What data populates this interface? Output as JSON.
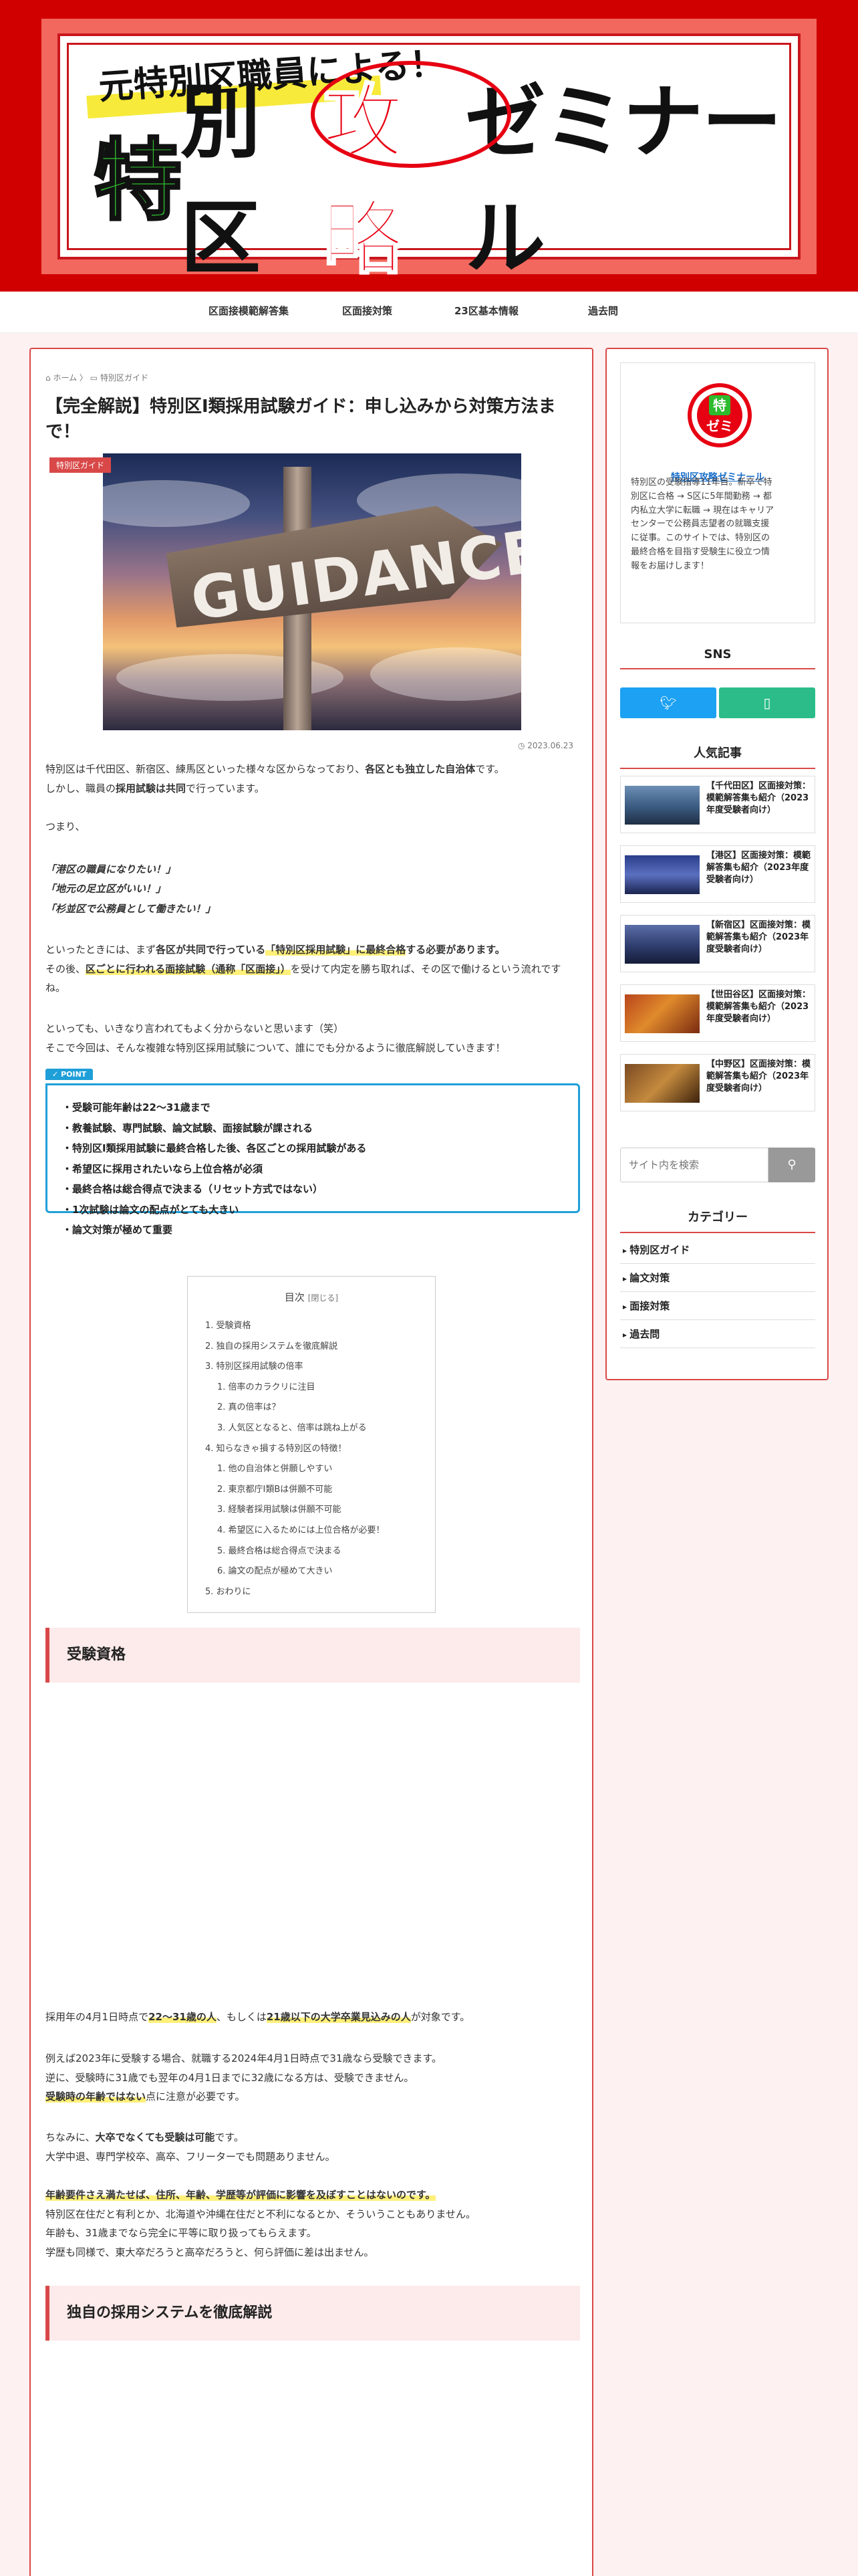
{
  "header": {
    "banner_sub": "元特別区職員による！",
    "banner_first": "特",
    "banner_mid": "別区",
    "banner_red": "攻略",
    "banner_last": "ゼミナール"
  },
  "nav": [
    "区面接模範解答集",
    "区面接対策",
    "23区基本情報",
    "過去問"
  ],
  "breadcrumb": {
    "home": "ホーム",
    "sep": "〉",
    "category": "特別区ガイド"
  },
  "article": {
    "title": "【完全解説】特別区Ⅰ類採用試験ガイド：申し込みから対策方法まで！",
    "category_badge": "特別区ガイド",
    "image_text": "GUIDANCE",
    "date": "2023.06.23",
    "intro1a": "特別区は千代田区、新宿区、練馬区といった様々な区からなっており、",
    "intro1b": "各区とも独立した自治体",
    "intro1c": "です。",
    "intro1d": "しかし、職員の",
    "intro1e": "採用試験は共同",
    "intro1f": "で行っています。",
    "tsumari": "つまり、",
    "quote1": "「港区の職員になりたい！」",
    "quote2": "「地元の足立区がいい！」",
    "quote3": "「杉並区で公務員として働きたい！」",
    "flow1a": "といったときには、まず",
    "flow1b": "各区が共同で行っている",
    "flow1c": "「特別区採用試験」に最終合格",
    "flow1d": "する必要があります。",
    "flow2a": "その後、",
    "flow2b": "区ごとに行われる面接試験（通称「区面接」）",
    "flow2c": "を受けて内定を勝ち取れば、その区で働けるという流れですね。",
    "lead1": "といっても、いきなり言われてもよく分からないと思います（笑）",
    "lead2": "そこで今回は、そんな複雑な特別区採用試験について、誰にでも分かるように徹底解説していきます！"
  },
  "point": {
    "tag": "POINT",
    "items": [
      "・受験可能年齢は22〜31歳まで",
      "・教養試験、専門試験、論文試験、面接試験が課される",
      "・特別区Ⅰ類採用試験に最終合格した後、各区ごとの採用試験がある",
      "・希望区に採用されたいなら上位合格が必須",
      "・最終合格は総合得点で決まる（リセット方式ではない）",
      "・1次試験は論文の配点がとても大きい",
      "・論文対策が極めて重要"
    ]
  },
  "toc": {
    "title": "目次",
    "toggle": "[閉じる]",
    "items": [
      {
        "label": "1. 受験資格",
        "sub": false
      },
      {
        "label": "2. 独自の採用システムを徹底解説",
        "sub": false
      },
      {
        "label": "3. 特別区採用試験の倍率",
        "sub": false
      },
      {
        "label": "1. 倍率のカラクリに注目",
        "sub": true
      },
      {
        "label": "2. 真の倍率は？",
        "sub": true
      },
      {
        "label": "3. 人気区となると、倍率は跳ね上がる",
        "sub": true
      },
      {
        "label": "4. 知らなきゃ損する特別区の特徴！",
        "sub": false
      },
      {
        "label": "1. 他の自治体と併願しやすい",
        "sub": true
      },
      {
        "label": "2. 東京都庁I類Bは併願不可能",
        "sub": true
      },
      {
        "label": "3. 経験者採用試験は併願不可能",
        "sub": true
      },
      {
        "label": "4. 希望区に入るためには上位合格が必要！",
        "sub": true
      },
      {
        "label": "5. 最終合格は総合得点で決まる",
        "sub": true
      },
      {
        "label": "6. 論文の配点が極めて大きい",
        "sub": true
      },
      {
        "label": "5. おわりに",
        "sub": false
      }
    ]
  },
  "section1": {
    "heading": "受験資格",
    "elig1a": "採用年の4月1日時点で",
    "elig1b": "22〜31歳の人",
    "elig1c": "、もしくは",
    "elig1d": "21歳以下の大学卒業見込みの人",
    "elig1e": "が対象です。",
    "ex1": "例えば2023年に受験する場合、就職する2024年4月1日時点で31歳なら受験できます。",
    "ex2": "逆に、受験時に31歳でも翌年の4月1日までに32歳になる方は、受験できません。",
    "ex3a": "受験時の年齢ではない",
    "ex3b": "点に注意が必要です。",
    "note1a": "ちなみに、",
    "note1b": "大卒でなくても受験は可能",
    "note1c": "です。",
    "note2": "大学中退、専門学校卒、高卒、フリーターでも問題ありません。",
    "fair1": "年齢要件さえ満たせば、住所、年齢、学歴等が評価に影響を及ぼすことはないのです。",
    "fair2": "特別区在住だと有利とか、北海道や沖縄在住だと不利になるとか、そういうこともありません。",
    "fair3": "年齢も、31歳までなら完全に平等に取り扱ってもらえます。",
    "fair4": "学歴も同様で、東大卒だろうと高卒だろうと、何ら評価に差は出ません。"
  },
  "section2": {
    "heading": "独自の採用システムを徹底解説"
  },
  "sidebar": {
    "logo_top": "特",
    "logo_bottom": "ゼミ",
    "profile_name": "特別区攻略ゼミナール",
    "profile_desc": "特別区の受験指導11年目。新卒で特別区に合格 → S区に5年間勤務 → 都内私立大学に転職 → 現在はキャリアセンターで公務員志望者の就職支援に従事。このサイトでは、特別区の最終合格を目指す受験生に役立つ情報をお届けします！",
    "sns_title": "SNS",
    "popular_title": "人気記事",
    "popular": [
      "【千代田区】区面接対策：模範解答集も紹介（2023年度受験者向け）",
      "【港区】区面接対策：模範解答集も紹介（2023年度受験者向け）",
      "【新宿区】区面接対策：模範解答集も紹介（2023年度受験者向け）",
      "【世田谷区】区面接対策：模範解答集も紹介（2023年度受験者向け）",
      "【中野区】区面接対策：模範解答集も紹介（2023年度受験者向け）"
    ],
    "search_placeholder": "サイト内を検索",
    "category_title": "カテゴリー",
    "categories": [
      "特別区ガイド",
      "論文対策",
      "面接対策",
      "過去問"
    ]
  },
  "colors": {
    "accent": "#d94848",
    "header_red": "#d10000",
    "point_blue": "#1f9fd8",
    "twitter": "#1da1f2",
    "feedly": "#2bbc8a"
  }
}
